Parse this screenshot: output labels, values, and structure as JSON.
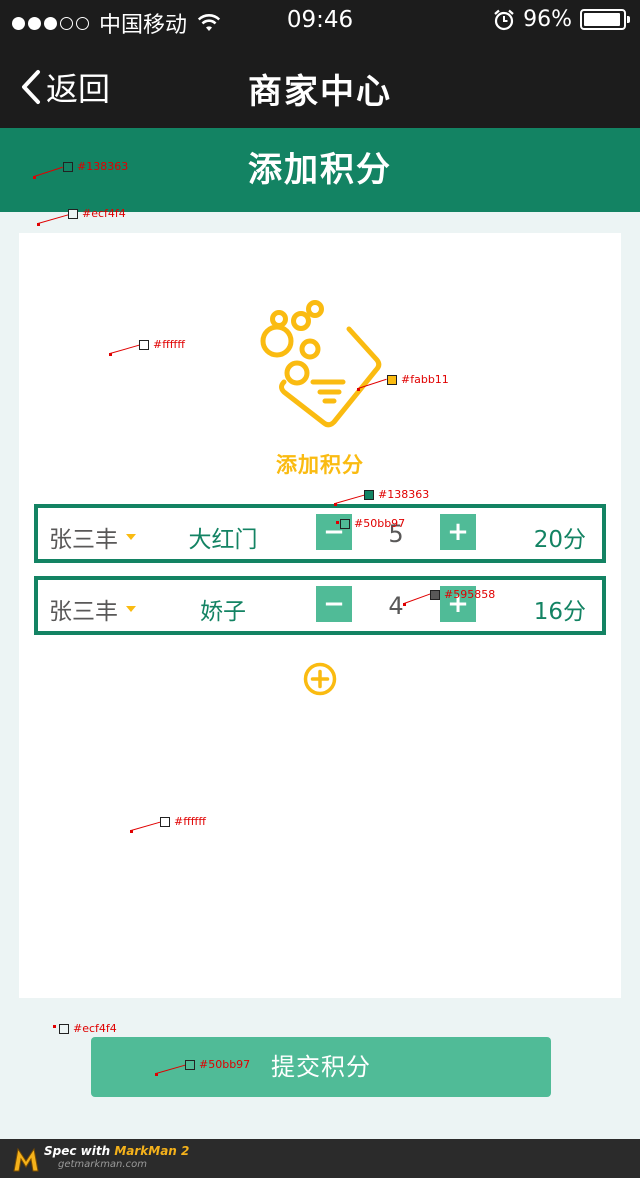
{
  "status_bar": {
    "carrier": "中国移动",
    "time": "09:46",
    "battery_text": "96%",
    "battery_level": 0.96,
    "signal_bars_filled": 3,
    "signal_bars_total": 5
  },
  "nav": {
    "back_label": "返回",
    "title": "商家中心"
  },
  "header": {
    "title": "添加积分"
  },
  "hero": {
    "title": "添加积分",
    "icon": "points-coupon-icon"
  },
  "rows": [
    {
      "person": "张三丰",
      "item": "大红门",
      "minus": "−",
      "qty": "5",
      "plus": "+",
      "points": "20分"
    },
    {
      "person": "张三丰",
      "item": "娇子",
      "minus": "−",
      "qty": "4",
      "plus": "+",
      "points": "16分"
    }
  ],
  "add_icon": "add-circle-icon",
  "submit": {
    "label": "提交积分"
  },
  "footer": {
    "line1_prefix": "Spec with ",
    "line1_brand": "MarkMan 2",
    "line2": "getmarkman.com"
  },
  "annotations": [
    {
      "label": "#138363",
      "color": "#138363"
    },
    {
      "label": "#ecf4f4",
      "color": "#ecf4f4"
    },
    {
      "label": "#ffffff",
      "color": "#ffffff"
    },
    {
      "label": "#fabb11",
      "color": "#fabb11"
    },
    {
      "label": "#138363",
      "color": "#138363"
    },
    {
      "label": "#50bb97",
      "color": "#50bb97"
    },
    {
      "label": "#595858",
      "color": "#595858"
    },
    {
      "label": "#ffffff",
      "color": "#ffffff"
    },
    {
      "label": "#ecf4f4",
      "color": "#ecf4f4"
    },
    {
      "label": "#50bb97",
      "color": "#50bb97"
    }
  ],
  "colors": {
    "primary_green": "#138363",
    "button_green": "#50bb97",
    "accent_yellow": "#fabb11",
    "text_gray": "#595858",
    "page_bg": "#ecf4f4",
    "card_bg": "#ffffff"
  }
}
